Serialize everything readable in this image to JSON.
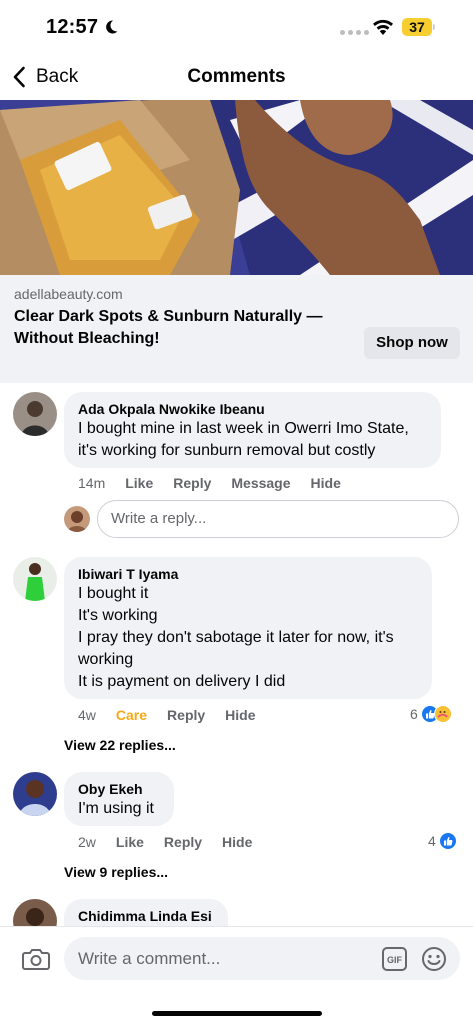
{
  "status_bar": {
    "time": "12:57",
    "battery": "37"
  },
  "nav": {
    "back_label": "Back",
    "title": "Comments"
  },
  "ad": {
    "domain": "adellabeauty.com",
    "headline": "Clear Dark Spots & Sunburn Naturally — Without Bleaching!",
    "cta": "Shop now"
  },
  "comments": [
    {
      "author": "Ada Okpala Nwokike Ibeanu",
      "text_lines": [
        "I bought mine in last week in Owerri Imo State,",
        "it's working for sunburn removal but costly"
      ],
      "time": "14m",
      "actions": [
        "Like",
        "Reply",
        "Message",
        "Hide"
      ]
    },
    {
      "author": "Ibiwari T Iyama",
      "text_lines": [
        "I bought it",
        "It's working",
        "I pray they don't sabotage it later for now, it's",
        "working",
        "It is payment on delivery I did"
      ],
      "time": "4w",
      "actions": [
        "Care",
        "Reply",
        "Hide"
      ],
      "reaction_count": "6",
      "view_replies": "View 22 replies..."
    },
    {
      "author": "Oby Ekeh",
      "text_lines": [
        "I'm using it"
      ],
      "time": "2w",
      "actions": [
        "Like",
        "Reply",
        "Hide"
      ],
      "reaction_count": "4",
      "view_replies": "View 9 replies..."
    },
    {
      "author": "Chidimma Linda Esi"
    }
  ],
  "reply_box": {
    "placeholder": "Write a reply..."
  },
  "composer": {
    "placeholder": "Write a comment...",
    "gif_label": "GIF"
  },
  "colors": {
    "accent_blue": "#1877f2",
    "care_yellow": "#f4a91a",
    "bubble_gray": "#f0f2f5"
  },
  "icons": [
    "moon-icon",
    "wifi-icon",
    "back-chevron-icon",
    "like-reaction-icon",
    "care-reaction-icon",
    "camera-icon",
    "gif-icon",
    "emoji-icon"
  ]
}
